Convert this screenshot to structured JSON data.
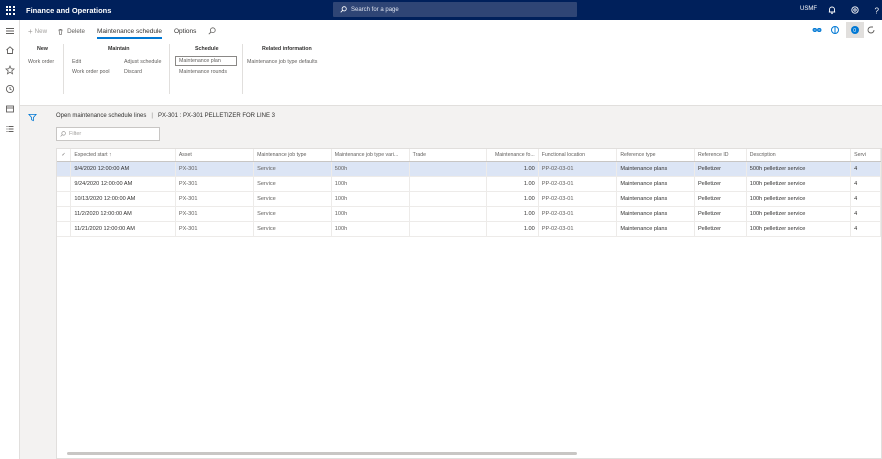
{
  "topbar": {
    "app_title": "Finance and Operations",
    "search_placeholder": "Search for a page",
    "company": "USMF"
  },
  "actionbar": {
    "new_label": "New",
    "delete_label": "Delete",
    "tabs": [
      {
        "label": "Maintenance schedule",
        "active": true
      },
      {
        "label": "Options",
        "active": false
      }
    ]
  },
  "groups": {
    "new": {
      "title": "New",
      "items": [
        "Work order"
      ]
    },
    "maintain": {
      "title": "Maintain",
      "items": [
        "Edit",
        "Work order pool",
        "Adjust schedule",
        "Discard"
      ]
    },
    "schedule": {
      "title": "Schedule",
      "items": [
        "Maintenance plan",
        "Maintenance rounds"
      ]
    },
    "related": {
      "title": "Related information",
      "items": [
        "Maintenance job type defaults"
      ]
    }
  },
  "caption": {
    "title": "Open maintenance schedule lines",
    "separator": "|",
    "context": "PX-301 : PX-301 PELLETIZER FOR LINE 3"
  },
  "filter": {
    "placeholder": "Filter"
  },
  "grid": {
    "columns": [
      "Expected start",
      "Asset",
      "Maintenance job type",
      "Maintenance job type vari...",
      "Trade",
      "Maintenance fo...",
      "Functional location",
      "Reference type",
      "Reference ID",
      "Description",
      "Servi"
    ],
    "rows": [
      [
        "9/4/2020 12:00:00 AM",
        "PX-301",
        "Service",
        "500h",
        "",
        "1.00",
        "PP-02-03-01",
        "Maintenance plans",
        "Pelletizer",
        "500h pelletizer service",
        "4"
      ],
      [
        "9/24/2020 12:00:00 AM",
        "PX-301",
        "Service",
        "100h",
        "",
        "1.00",
        "PP-02-03-01",
        "Maintenance plans",
        "Pelletizer",
        "100h pelletizer service",
        "4"
      ],
      [
        "10/13/2020 12:00:00 AM",
        "PX-301",
        "Service",
        "100h",
        "",
        "1.00",
        "PP-02-03-01",
        "Maintenance plans",
        "Pelletizer",
        "100h pelletizer service",
        "4"
      ],
      [
        "11/2/2020 12:00:00 AM",
        "PX-301",
        "Service",
        "100h",
        "",
        "1.00",
        "PP-02-03-01",
        "Maintenance plans",
        "Pelletizer",
        "100h pelletizer service",
        "4"
      ],
      [
        "11/21/2020 12:00:00 AM",
        "PX-301",
        "Service",
        "100h",
        "",
        "1.00",
        "PP-02-03-01",
        "Maintenance plans",
        "Pelletizer",
        "100h pelletizer service",
        "4"
      ]
    ],
    "selected_row": 0
  },
  "colors": {
    "topbar": "#00205b",
    "accent": "#0078d4",
    "selected_row": "#dce5f5"
  }
}
